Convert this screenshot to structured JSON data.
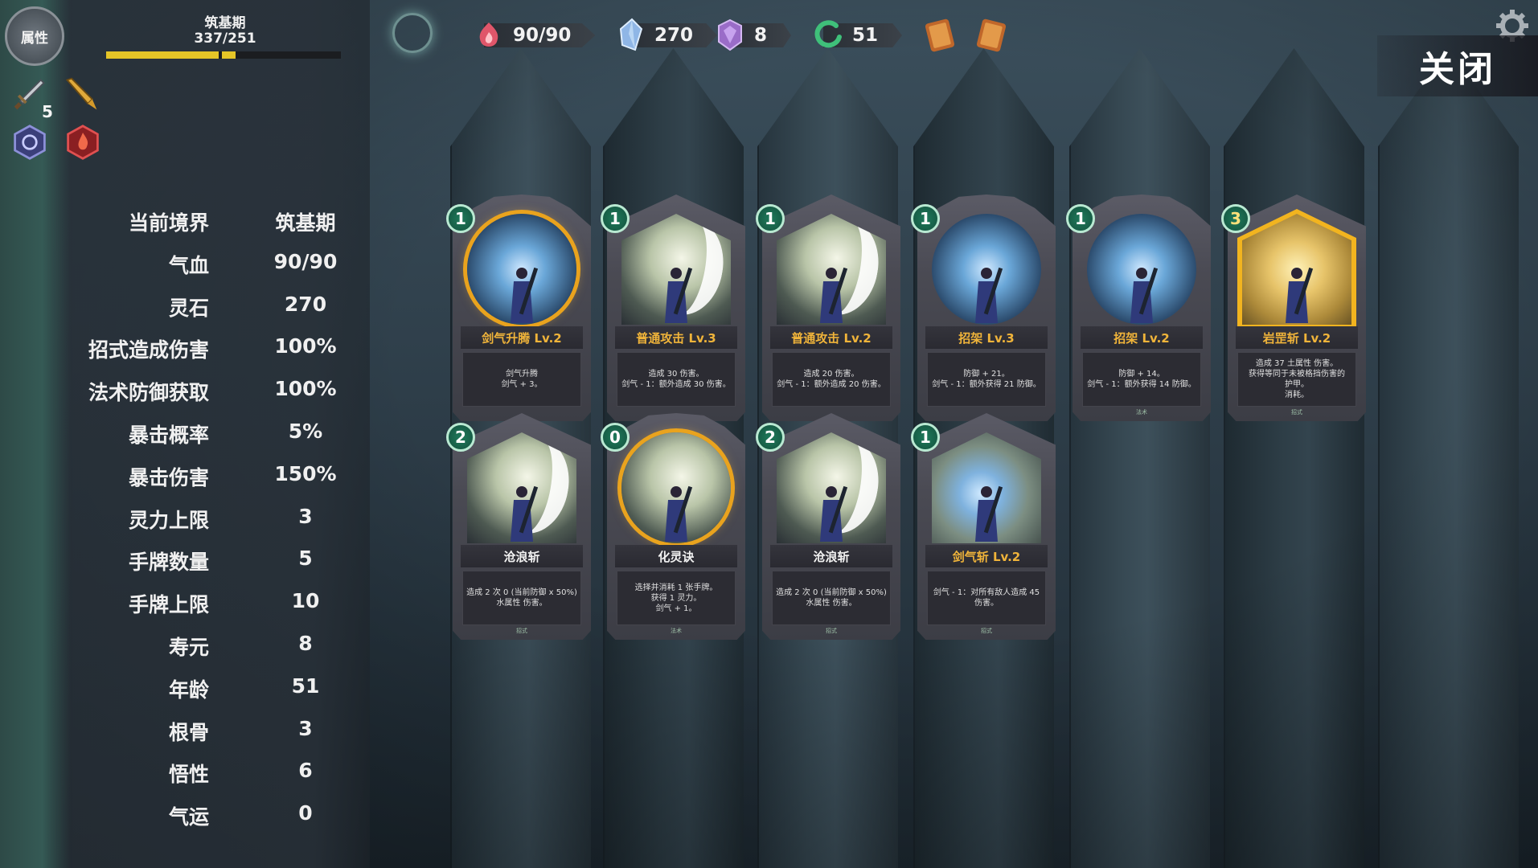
{
  "left_panel": {
    "attr_button": "属性",
    "realm": "筑基期",
    "exp_text": "337/251",
    "exp_fill": 0.55,
    "equip_count": "5"
  },
  "stats": [
    {
      "label": "当前境界",
      "value": "筑基期"
    },
    {
      "label": "气血",
      "value": "90/90"
    },
    {
      "label": "灵石",
      "value": "270"
    },
    {
      "label": "招式造成伤害",
      "value": "100%"
    },
    {
      "label": "法术防御获取",
      "value": "100%"
    },
    {
      "label": "暴击概率",
      "value": "5%"
    },
    {
      "label": "暴击伤害",
      "value": "150%"
    },
    {
      "label": "灵力上限",
      "value": "3"
    },
    {
      "label": "手牌数量",
      "value": "5"
    },
    {
      "label": "手牌上限",
      "value": "10"
    },
    {
      "label": "寿元",
      "value": "8"
    },
    {
      "label": "年龄",
      "value": "51"
    },
    {
      "label": "根骨",
      "value": "3"
    },
    {
      "label": "悟性",
      "value": "6"
    },
    {
      "label": "气运",
      "value": "0"
    }
  ],
  "resources": [
    {
      "icon": "heart-flame-icon",
      "value": "90/90",
      "color": "#e0566a"
    },
    {
      "icon": "crystal-icon",
      "value": "270",
      "color": "#8fb6e6"
    },
    {
      "icon": "gem-icon",
      "value": "8",
      "color": "#9a6cc8"
    },
    {
      "icon": "age-ring-icon",
      "value": "51",
      "color": "#3fc07a"
    }
  ],
  "close_label": "关闭",
  "cards": [
    {
      "cost": "1",
      "title": "剑气升腾 Lv.2",
      "lines": [
        "剑气升腾",
        "剑气 + 3。"
      ],
      "shape": "circle",
      "type": "",
      "title_color": "gold"
    },
    {
      "cost": "1",
      "title": "普通攻击 Lv.3",
      "lines": [
        "造成 30 伤害。",
        "剑气 - 1：额外造成 30 伤害。"
      ],
      "shape": "hex",
      "type": "",
      "title_color": "gold"
    },
    {
      "cost": "1",
      "title": "普通攻击 Lv.2",
      "lines": [
        "造成 20 伤害。",
        "剑气 - 1：额外造成 20 伤害。"
      ],
      "shape": "hex",
      "type": "",
      "title_color": "gold"
    },
    {
      "cost": "1",
      "title": "招架 Lv.3",
      "lines": [
        "防御 + 21。",
        "剑气 - 1：额外获得 21 防御。"
      ],
      "shape": "circle",
      "type": "",
      "title_color": "gold"
    },
    {
      "cost": "1",
      "title": "招架 Lv.2",
      "lines": [
        "防御 + 14。",
        "剑气 - 1：额外获得 14 防御。"
      ],
      "shape": "circle",
      "type": "法术",
      "title_color": "gold"
    },
    {
      "cost": "3",
      "title": "岩罡斩 Lv.2",
      "lines": [
        "造成 37 土属性 伤害。",
        "获得等同于未被格挡伤害的",
        "护甲。",
        "消耗。"
      ],
      "shape": "hex-gold",
      "type": "招式",
      "title_color": "gold"
    },
    {
      "cost": "2",
      "title": "沧浪斩",
      "lines": [
        "造成 2 次 0 (当前防御 x 50%)",
        "水属性 伤害。"
      ],
      "shape": "hex",
      "type": "招式",
      "title_color": "white"
    },
    {
      "cost": "0",
      "title": "化灵诀",
      "lines": [
        "选择并消耗 1 张手牌。",
        "获得 1 灵力。",
        "剑气 + 1。"
      ],
      "shape": "circle-gold",
      "type": "法术",
      "title_color": "white"
    },
    {
      "cost": "2",
      "title": "沧浪斩",
      "lines": [
        "造成 2 次 0 (当前防御 x 50%)",
        "水属性 伤害。"
      ],
      "shape": "hex",
      "type": "招式",
      "title_color": "white"
    },
    {
      "cost": "1",
      "title": "剑气斩 Lv.2",
      "lines": [
        "剑气 - 1：对所有敌人造成 45",
        "伤害。"
      ],
      "shape": "hex-blue",
      "type": "招式",
      "title_color": "gold"
    }
  ]
}
